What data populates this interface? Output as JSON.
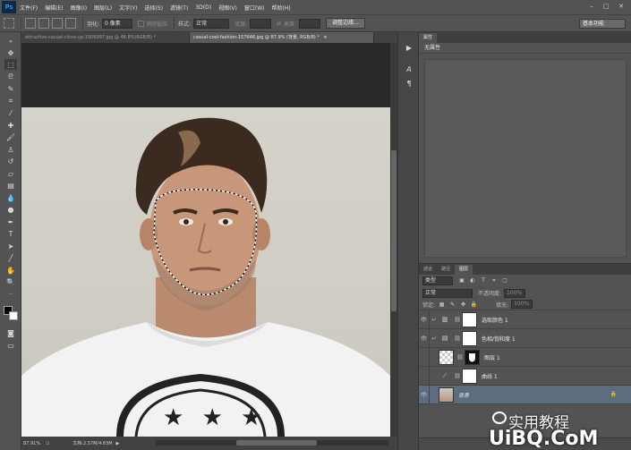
{
  "app": {
    "logo": "Ps"
  },
  "menu": [
    "文件(F)",
    "编辑(E)",
    "图像(I)",
    "图层(L)",
    "文字(Y)",
    "选择(S)",
    "滤镜(T)",
    "3D(D)",
    "视图(V)",
    "窗口(W)",
    "帮助(H)"
  ],
  "options": {
    "feather_label": "羽化:",
    "feather_value": "0 像素",
    "antialias_label": "消除锯齿",
    "style_label": "样式:",
    "style_value": "正常",
    "width_label": "宽度:",
    "height_label": "高度:",
    "refine_button": "调整边缘...",
    "workspace": "基本功能"
  },
  "tabs": [
    {
      "label": "attractive-casual-close-up-1906997.jpg @ 48.8%(RGB/8) *"
    },
    {
      "label": "casual-cool-fashion-157646.jpg @ 87.9% (背景, RGB/8) *"
    }
  ],
  "status": {
    "zoom": "87.91%",
    "doc": "文档:2.57M/4.63M"
  },
  "properties": {
    "tab": "属性",
    "subtitle": "无属性"
  },
  "layers_panel": {
    "tabs": [
      "通道",
      "路径",
      "图层"
    ],
    "kind": "类型",
    "blend": "正常",
    "opacity_label": "不透明度:",
    "opacity_value": "100%",
    "lock_label": "锁定:",
    "fill_label": "填充:",
    "fill_value": "100%",
    "layers": [
      {
        "name": "选取颜色 1"
      },
      {
        "name": "色相/饱和度 1"
      },
      {
        "name": "图层 1"
      },
      {
        "name": "曲线 1"
      },
      {
        "name": "背景"
      }
    ]
  },
  "watermark": {
    "line1": "实用教程",
    "line2": "UiBQ.CoM"
  },
  "shirt_badge": "★ ★ ★"
}
